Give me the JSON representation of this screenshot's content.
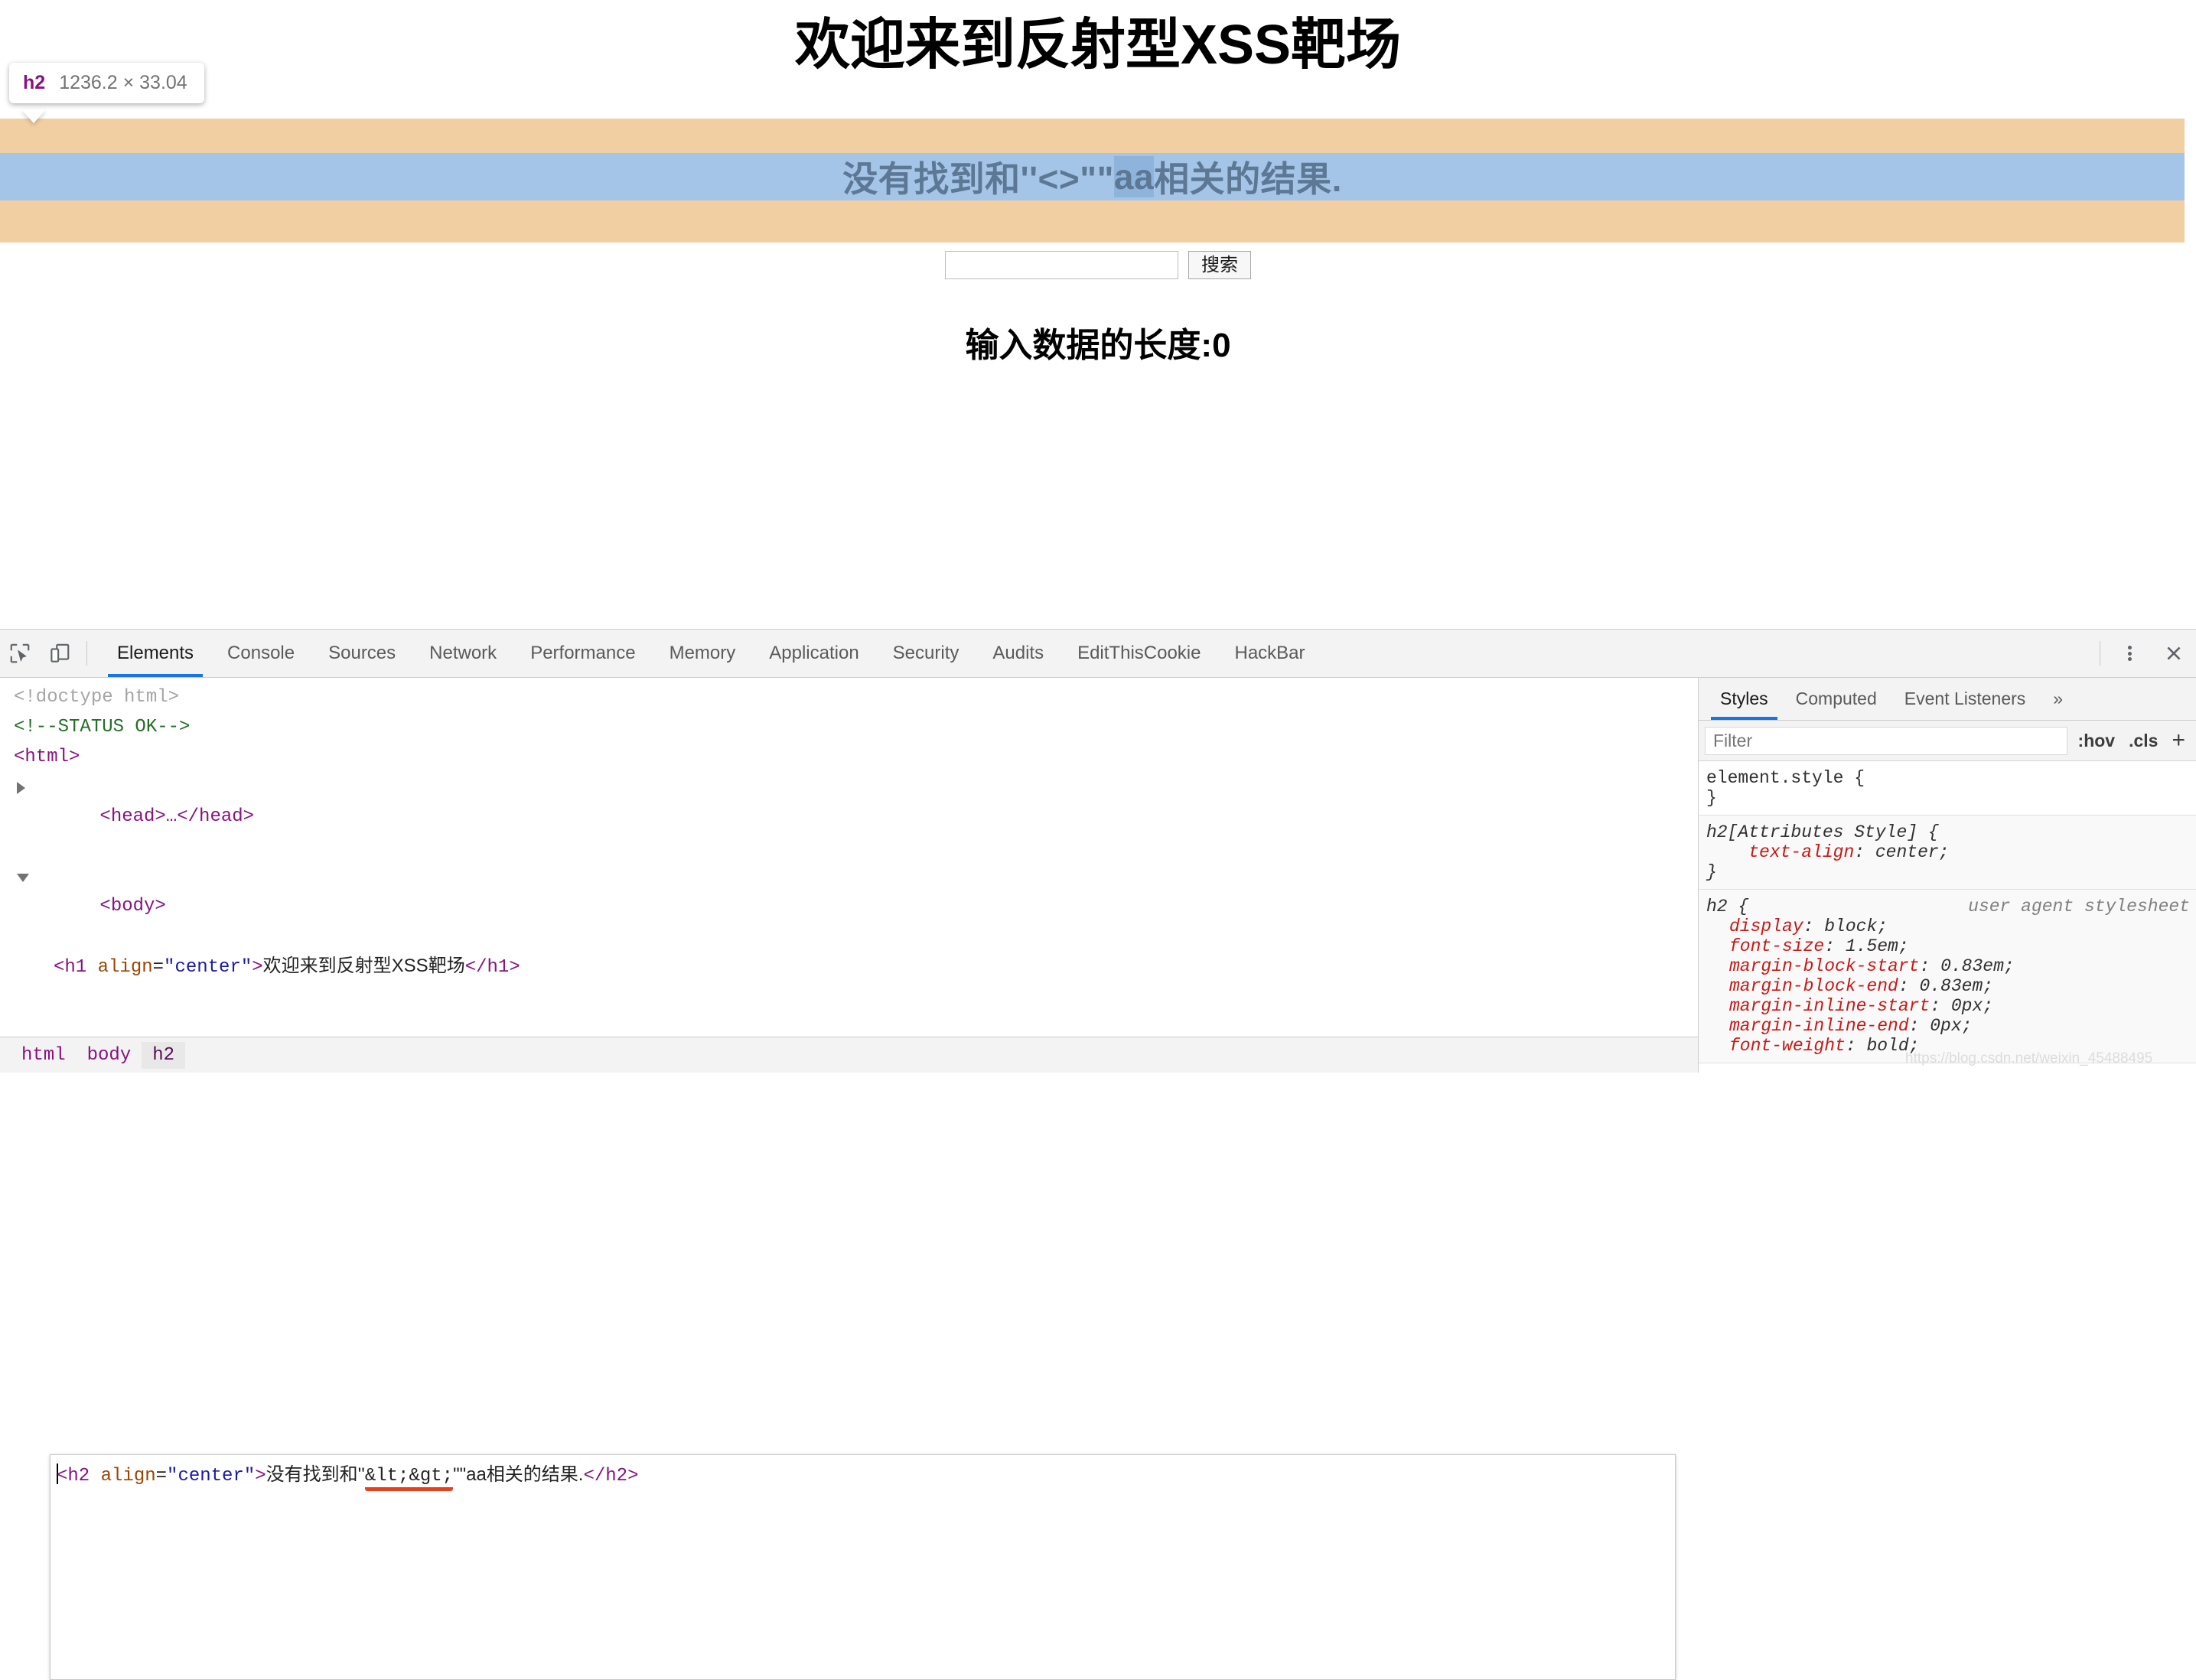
{
  "page": {
    "h1": "欢迎来到反射型XSS靶场",
    "h2_before": "没有找到和''<>\"\"",
    "h2_selected": "aa",
    "h2_after": "相关的结果.",
    "search_input_value": "",
    "search_input_placeholder": "",
    "search_button_label": "搜索",
    "length_label": "输入数据的长度:0"
  },
  "inspect_tooltip": {
    "tag": "h2",
    "dimensions": "1236.2 × 33.04"
  },
  "highlight_colors": {
    "margin": "#F2CEA3",
    "content": "#A5C5E8",
    "selection": "#8FB4DC"
  },
  "devtools": {
    "icons": {
      "inspect": "inspect-element-icon",
      "device": "device-toolbar-icon",
      "kebab": "more-options-icon",
      "close": "close-icon"
    },
    "tabs": [
      {
        "label": "Elements",
        "active": true
      },
      {
        "label": "Console",
        "active": false
      },
      {
        "label": "Sources",
        "active": false
      },
      {
        "label": "Network",
        "active": false
      },
      {
        "label": "Performance",
        "active": false
      },
      {
        "label": "Memory",
        "active": false
      },
      {
        "label": "Application",
        "active": false
      },
      {
        "label": "Security",
        "active": false
      },
      {
        "label": "Audits",
        "active": false
      },
      {
        "label": "EditThisCookie",
        "active": false
      },
      {
        "label": "HackBar",
        "active": false
      }
    ],
    "dom": {
      "line_doctype": "<!doctype html>",
      "line_comment": "<!--STATUS OK-->",
      "line_html_open": "<html>",
      "line_head": "<head>…</head>",
      "line_body": "<body>",
      "h1_tag": "h1",
      "h1_attr": "align",
      "h1_attr_value": "\"center\"",
      "h1_text": "欢迎来到反射型XSS靶场",
      "h1_close": "</h1>",
      "edit_tag": "h2",
      "edit_attr": "align",
      "edit_attr_value": "\"center\"",
      "edit_text_before": "没有找到和''",
      "edit_entity": "&lt;&gt;",
      "edit_text_after": "\"\"aa相关的结果.",
      "edit_close": "</h2>"
    },
    "breadcrumb": [
      {
        "label": "html",
        "active": false
      },
      {
        "label": "body",
        "active": false
      },
      {
        "label": "h2",
        "active": true
      }
    ]
  },
  "styles_panel": {
    "tabs": [
      {
        "label": "Styles",
        "active": true
      },
      {
        "label": "Computed",
        "active": false
      },
      {
        "label": "Event Listeners",
        "active": false
      },
      {
        "label": "»",
        "active": false
      }
    ],
    "filter_placeholder": "Filter",
    "hov_label": ":hov",
    "cls_label": ".cls",
    "plus_label": "+",
    "rules": {
      "element_style_open": "element.style {",
      "element_style_close": "}",
      "attr_rule_sel": "h2[Attributes Style] {",
      "attr_rule_prop": "text-align",
      "attr_rule_val": "center;",
      "attr_rule_close": "}",
      "ua_rule_sel": "h2 {",
      "ua_rule_source": "user agent stylesheet",
      "ua_props": [
        {
          "name": "display",
          "value": "block;"
        },
        {
          "name": "font-size",
          "value": "1.5em;"
        },
        {
          "name": "margin-block-start",
          "value": "0.83em;"
        },
        {
          "name": "margin-block-end",
          "value": "0.83em;"
        },
        {
          "name": "margin-inline-start",
          "value": "0px;"
        },
        {
          "name": "margin-inline-end",
          "value": "0px;"
        },
        {
          "name": "font-weight",
          "value": "bold;"
        }
      ]
    }
  },
  "watermark": "https://blog.csdn.net/weixin_45488495"
}
